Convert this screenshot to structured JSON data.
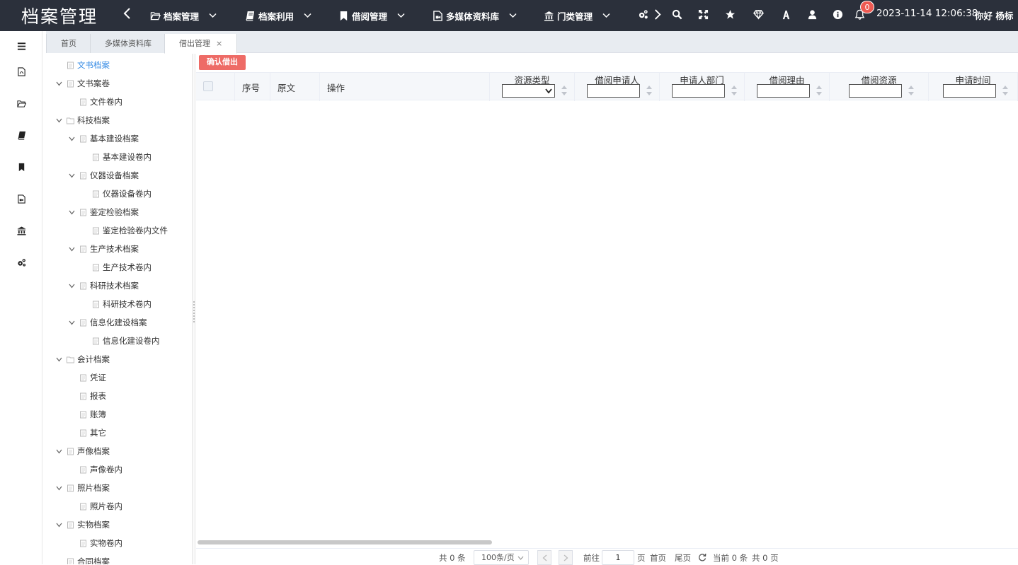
{
  "header": {
    "brand": "档案管理",
    "menus": [
      {
        "label": "档案管理",
        "icon": "folder-open-icon"
      },
      {
        "label": "档案利用",
        "icon": "book-icon"
      },
      {
        "label": "借阅管理",
        "icon": "bookmark-icon"
      },
      {
        "label": "多媒体资料库",
        "icon": "media-file-icon"
      },
      {
        "label": "门类管理",
        "icon": "institution-icon"
      }
    ],
    "tools": [
      "gears-icon",
      "search-icon",
      "fullscreen-icon",
      "star-icon",
      "diamond-icon",
      "font-icon",
      "user-icon",
      "info-icon",
      "bell-icon"
    ],
    "notification_count": "0",
    "datetime": "2023-11-14 12:06:38",
    "greeting": "你好 杨标"
  },
  "rail": [
    "menu-toggle-icon",
    "document-icon",
    "folder-open-icon",
    "book-icon",
    "bookmark-icon",
    "media-file-icon",
    "institution-icon",
    "gears-icon"
  ],
  "tabs": [
    {
      "label": "首页"
    },
    {
      "label": "多媒体资料库"
    },
    {
      "label": "借出管理",
      "close": "×"
    }
  ],
  "tree": [
    {
      "label": "文书档案",
      "level": 0,
      "toggle": false,
      "icon": "doc",
      "selected": true
    },
    {
      "label": "文书案卷",
      "level": 0,
      "toggle": true,
      "icon": "doc"
    },
    {
      "label": "文件卷内",
      "level": 1,
      "toggle": false,
      "icon": "doc"
    },
    {
      "label": "科技档案",
      "level": 0,
      "toggle": true,
      "icon": "folder"
    },
    {
      "label": "基本建设档案",
      "level": 1,
      "toggle": true,
      "icon": "doc"
    },
    {
      "label": "基本建设卷内",
      "level": 2,
      "toggle": false,
      "icon": "doc"
    },
    {
      "label": "仪器设备档案",
      "level": 1,
      "toggle": true,
      "icon": "doc"
    },
    {
      "label": "仪器设备卷内",
      "level": 2,
      "toggle": false,
      "icon": "doc"
    },
    {
      "label": "鉴定检验档案",
      "level": 1,
      "toggle": true,
      "icon": "doc"
    },
    {
      "label": "鉴定检验卷内文件",
      "level": 2,
      "toggle": false,
      "icon": "doc"
    },
    {
      "label": "生产技术档案",
      "level": 1,
      "toggle": true,
      "icon": "doc"
    },
    {
      "label": "生产技术卷内",
      "level": 2,
      "toggle": false,
      "icon": "doc"
    },
    {
      "label": "科研技术档案",
      "level": 1,
      "toggle": true,
      "icon": "doc"
    },
    {
      "label": "科研技术卷内",
      "level": 2,
      "toggle": false,
      "icon": "doc"
    },
    {
      "label": "信息化建设档案",
      "level": 1,
      "toggle": true,
      "icon": "doc"
    },
    {
      "label": "信息化建设卷内",
      "level": 2,
      "toggle": false,
      "icon": "doc"
    },
    {
      "label": "会计档案",
      "level": 0,
      "toggle": true,
      "icon": "folder"
    },
    {
      "label": "凭证",
      "level": 1,
      "toggle": false,
      "icon": "doc"
    },
    {
      "label": "报表",
      "level": 1,
      "toggle": false,
      "icon": "doc"
    },
    {
      "label": "账簿",
      "level": 1,
      "toggle": false,
      "icon": "doc"
    },
    {
      "label": "其它",
      "level": 1,
      "toggle": false,
      "icon": "doc"
    },
    {
      "label": "声像档案",
      "level": 0,
      "toggle": true,
      "icon": "doc"
    },
    {
      "label": "声像卷内",
      "level": 1,
      "toggle": false,
      "icon": "doc"
    },
    {
      "label": "照片档案",
      "level": 0,
      "toggle": true,
      "icon": "doc"
    },
    {
      "label": "照片卷内",
      "level": 1,
      "toggle": false,
      "icon": "doc"
    },
    {
      "label": "实物档案",
      "level": 0,
      "toggle": true,
      "icon": "doc"
    },
    {
      "label": "实物卷内",
      "level": 1,
      "toggle": false,
      "icon": "doc"
    },
    {
      "label": "合同档案",
      "level": 0,
      "toggle": false,
      "icon": "doc"
    }
  ],
  "toolbar": {
    "confirm_label": "确认借出"
  },
  "grid": {
    "plain_columns": [
      "序号",
      "原文",
      "操作"
    ],
    "filter_columns": [
      {
        "title": "资源类型",
        "type": "select",
        "value": ""
      },
      {
        "title": "借阅申请人",
        "type": "input",
        "value": ""
      },
      {
        "title": "申请人部门",
        "type": "input",
        "value": ""
      },
      {
        "title": "借阅理由",
        "type": "input",
        "value": ""
      },
      {
        "title": "借阅资源",
        "type": "input",
        "value": ""
      },
      {
        "title": "申请时间",
        "type": "input",
        "value": ""
      }
    ],
    "rows": []
  },
  "pager": {
    "total_prefix": "共",
    "total": "0",
    "total_suffix": "条",
    "page_size": "100条/页",
    "goto_prefix": "前往",
    "page": "1",
    "goto_suffix": "页",
    "first": "首页",
    "last": "尾页",
    "current_label": "当前",
    "current_count": "0",
    "current_suffix": "条",
    "pages_prefix": "共",
    "pages": "0",
    "pages_suffix": "页"
  }
}
